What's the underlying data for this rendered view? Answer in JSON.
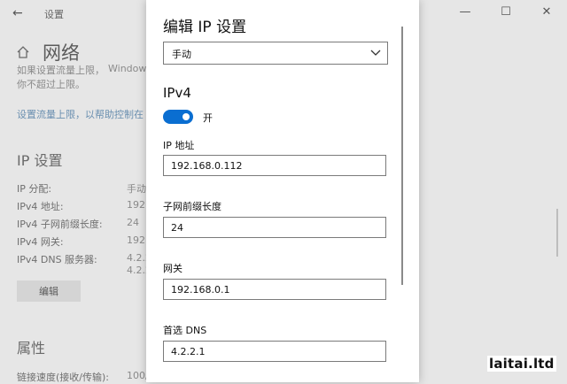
{
  "window": {
    "title": "设置",
    "back_glyph": "←",
    "min_glyph": "—",
    "max_glyph": "☐",
    "close_glyph": "✕"
  },
  "background": {
    "page_title": "网络",
    "faded_line_1a": "如果设置流量上限，",
    "faded_line_1b": "Windows",
    "faded_line_2": "你不超过上限。",
    "link_text": "设置流量上限，以帮助控制在",
    "ip_section_title": "IP 设置",
    "ip_rows": [
      {
        "label": "IP 分配:",
        "value": "手动"
      },
      {
        "label": "IPv4 地址:",
        "value": "192."
      },
      {
        "label": "IPv4 子网前缀长度:",
        "value": "24"
      },
      {
        "label": "IPv4 网关:",
        "value": "192."
      },
      {
        "label": "IPv4 DNS 服务器:",
        "value": "4.2.2"
      },
      {
        "label": "",
        "value": "4.2.2"
      }
    ],
    "edit_button": "编辑",
    "props_title": "属性",
    "link_speed_label": "链接速度(接收/传输):",
    "link_speed_value": "100/"
  },
  "dialog": {
    "title": "编辑 IP 设置",
    "mode_select": "手动",
    "ipv4_heading": "IPv4",
    "toggle_label": "开",
    "toggle_on": true,
    "fields": {
      "ip_label": "IP 地址",
      "ip_value": "192.168.0.112",
      "prefix_label": "子网前缀长度",
      "prefix_value": "24",
      "gateway_label": "网关",
      "gateway_value": "192.168.0.1",
      "dns_label": "首选 DNS",
      "dns_value": "4.2.2.1"
    }
  },
  "watermark": "laitai.ltd",
  "colors": {
    "accent": "#0a6ed1",
    "link": "#6a8fb0"
  }
}
